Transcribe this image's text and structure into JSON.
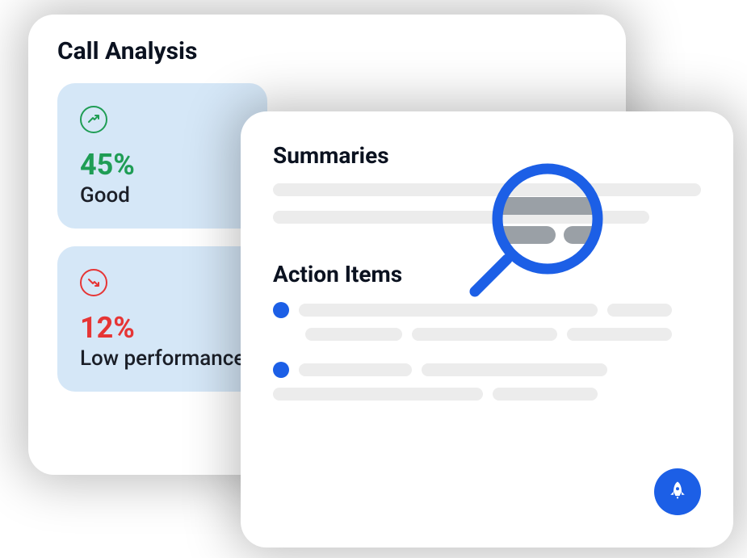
{
  "callAnalysis": {
    "title": "Call Analysis",
    "stats": [
      {
        "value": "45%",
        "label": "Good",
        "tone": "green"
      },
      {
        "value": "12%",
        "label": "Low performance",
        "tone": "red"
      }
    ]
  },
  "summaries": {
    "title": "Summaries"
  },
  "actionItems": {
    "title": "Action Items"
  },
  "colors": {
    "accent": "#1c5fe6",
    "good": "#1f9d55",
    "bad": "#e63535"
  }
}
